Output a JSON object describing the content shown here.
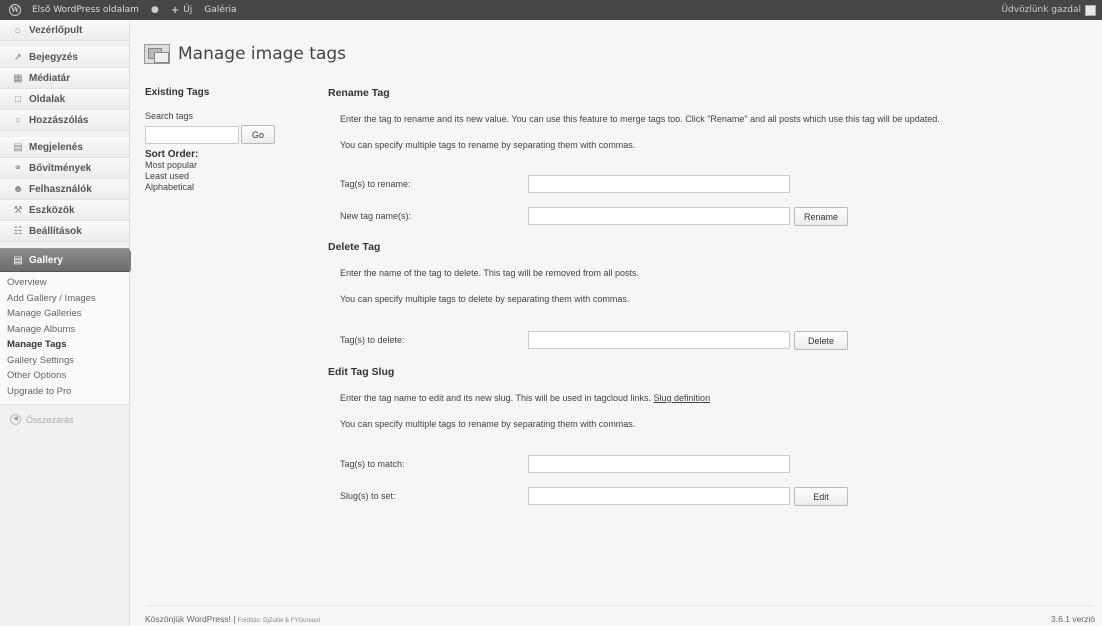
{
  "adminbar": {
    "site_name": "Első WordPress oldalam",
    "new_label": "Új",
    "gallery_label": "Galéria",
    "greeting": "Üdvözlünk gazdal"
  },
  "sidebar": {
    "items": [
      {
        "label": "Vezérlőpult",
        "icon": "dashboard-icon"
      },
      {
        "label": "Bejegyzés",
        "icon": "pin-icon"
      },
      {
        "label": "Médiatár",
        "icon": "media-icon"
      },
      {
        "label": "Oldalak",
        "icon": "pages-icon"
      },
      {
        "label": "Hozzászólás",
        "icon": "comments-icon"
      },
      {
        "label": "Megjelenés",
        "icon": "appearance-icon"
      },
      {
        "label": "Bővítmények",
        "icon": "plugins-icon"
      },
      {
        "label": "Felhasználók",
        "icon": "users-icon"
      },
      {
        "label": "Eszközök",
        "icon": "tools-icon"
      },
      {
        "label": "Beállítások",
        "icon": "settings-icon"
      },
      {
        "label": "Gallery",
        "icon": "gallery-icon"
      }
    ],
    "submenu": [
      "Overview",
      "Add Gallery / Images",
      "Manage Galleries",
      "Manage Albums",
      "Manage Tags",
      "Gallery Settings",
      "Other Options",
      "Upgrade to Pro"
    ],
    "collapse_label": "Összezárás"
  },
  "page": {
    "title": "Manage image tags"
  },
  "existing_tags": {
    "heading": "Existing Tags",
    "search_label": "Search tags",
    "search_value": "",
    "go_label": "Go",
    "sort_heading": "Sort Order:",
    "sort_options": [
      "Most popular",
      "Least used",
      "Alphabetical"
    ]
  },
  "rename": {
    "title": "Rename Tag",
    "desc1": "Enter the tag to rename and its new value. You can use this feature to merge tags too. Click \"Rename\" and all posts which use this tag will be updated.",
    "desc2": "You can specify multiple tags to rename by separating them with commas.",
    "field1_label": "Tag(s) to rename:",
    "field2_label": "New tag name(s):",
    "button": "Rename"
  },
  "delete": {
    "title": "Delete Tag",
    "desc1": "Enter the name of the tag to delete. This tag will be removed from all posts.",
    "desc2": "You can specify multiple tags to delete by separating them with commas.",
    "field_label": "Tag(s) to delete:",
    "button": "Delete"
  },
  "slug": {
    "title": "Edit Tag Slug",
    "desc1": "Enter the tag name to edit and its new slug. This will be used in tagcloud links.",
    "desc1_link": "Slug definition",
    "desc2": "You can specify multiple tags to rename by separating them with commas.",
    "field1_label": "Tag(s) to match:",
    "field2_label": "Slug(s) to set:",
    "button": "Edit"
  },
  "footer": {
    "thanks": "Köszönjük WordPress!",
    "credits": "Fordítás: DjZuNe & FYGureout",
    "version": "3.6.1 verzió"
  }
}
